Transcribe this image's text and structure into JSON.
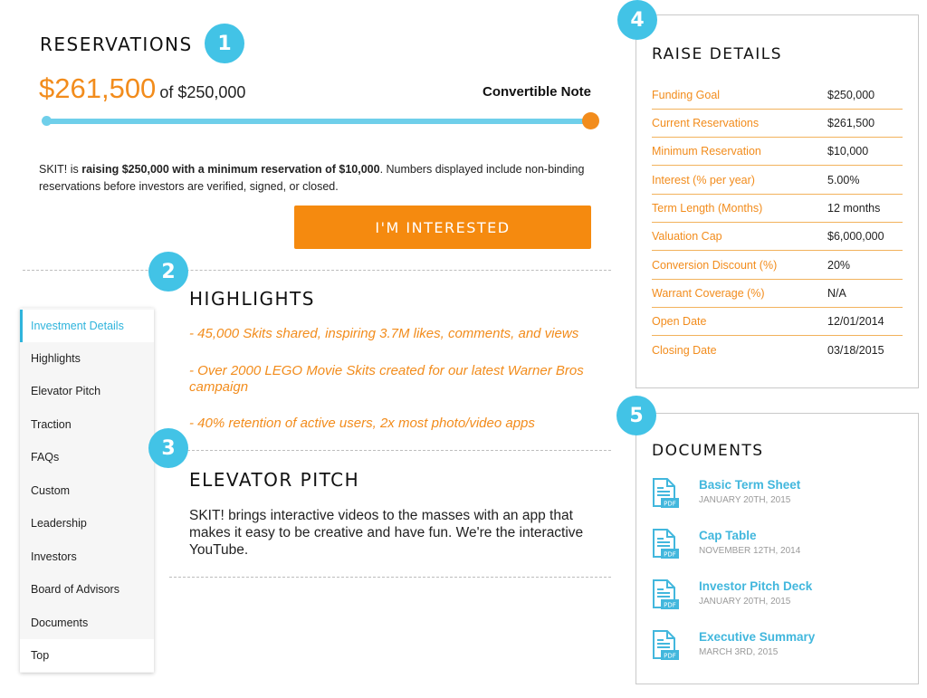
{
  "badges": [
    "1",
    "2",
    "3",
    "4",
    "5"
  ],
  "reservations": {
    "title": "RESERVATIONS",
    "amount": "$261,500",
    "of_text": "of $250,000",
    "note_type": "Convertible Note",
    "progress": 1.0,
    "desc_prefix": "SKIT! is ",
    "desc_bold": "raising $250,000 with a minimum reservation of $10,000",
    "desc_suffix": ". Numbers displayed include non-binding reservations before investors are verified, signed, or closed.",
    "cta_label": "I'M INTERESTED"
  },
  "sidebar": {
    "items": [
      "Investment Details",
      "Highlights",
      "Elevator Pitch",
      "Traction",
      "FAQs",
      "Custom",
      "Leadership",
      "Investors",
      "Board of Advisors",
      "Documents",
      "Top"
    ]
  },
  "highlights": {
    "title": "HIGHLIGHTS",
    "items": [
      "- 45,000 Skits shared, inspiring 3.7M likes, comments, and views",
      "- Over 2000 LEGO Movie Skits created for our latest Warner Bros campaign",
      "- 40% retention of active users, 2x most photo/video apps"
    ]
  },
  "pitch": {
    "title": "ELEVATOR PITCH",
    "text": "SKIT! brings interactive videos to the masses with an app that makes it easy to be creative and have fun. We're the interactive YouTube."
  },
  "raise": {
    "title": "RAISE DETAILS",
    "rows": [
      {
        "label": "Funding Goal",
        "value": "$250,000"
      },
      {
        "label": "Current Reservations",
        "value": "$261,500"
      },
      {
        "label": "Minimum Reservation",
        "value": "$10,000"
      },
      {
        "label": "Interest (% per year)",
        "value": "5.00%"
      },
      {
        "label": "Term Length (Months)",
        "value": "12 months"
      },
      {
        "label": "Valuation Cap",
        "value": "$6,000,000"
      },
      {
        "label": "Conversion Discount (%)",
        "value": "20%"
      },
      {
        "label": "Warrant Coverage (%)",
        "value": "N/A"
      },
      {
        "label": "Open Date",
        "value": "12/01/2014"
      },
      {
        "label": "Closing Date",
        "value": "03/18/2015"
      }
    ]
  },
  "documents": {
    "title": "DOCUMENTS",
    "pdf_label": "PDF",
    "icon": "pdf-file-icon",
    "items": [
      {
        "title": "Basic Term Sheet",
        "date": "JANUARY 20TH, 2015"
      },
      {
        "title": "Cap Table",
        "date": "NOVEMBER 12TH, 2014"
      },
      {
        "title": "Investor Pitch Deck",
        "date": "JANUARY 20TH, 2015"
      },
      {
        "title": "Executive Summary",
        "date": "MARCH 3RD, 2015"
      }
    ]
  },
  "colors": {
    "accent_orange": "#f28c1c",
    "accent_blue": "#42c3e6",
    "button_orange": "#f58a0f"
  }
}
